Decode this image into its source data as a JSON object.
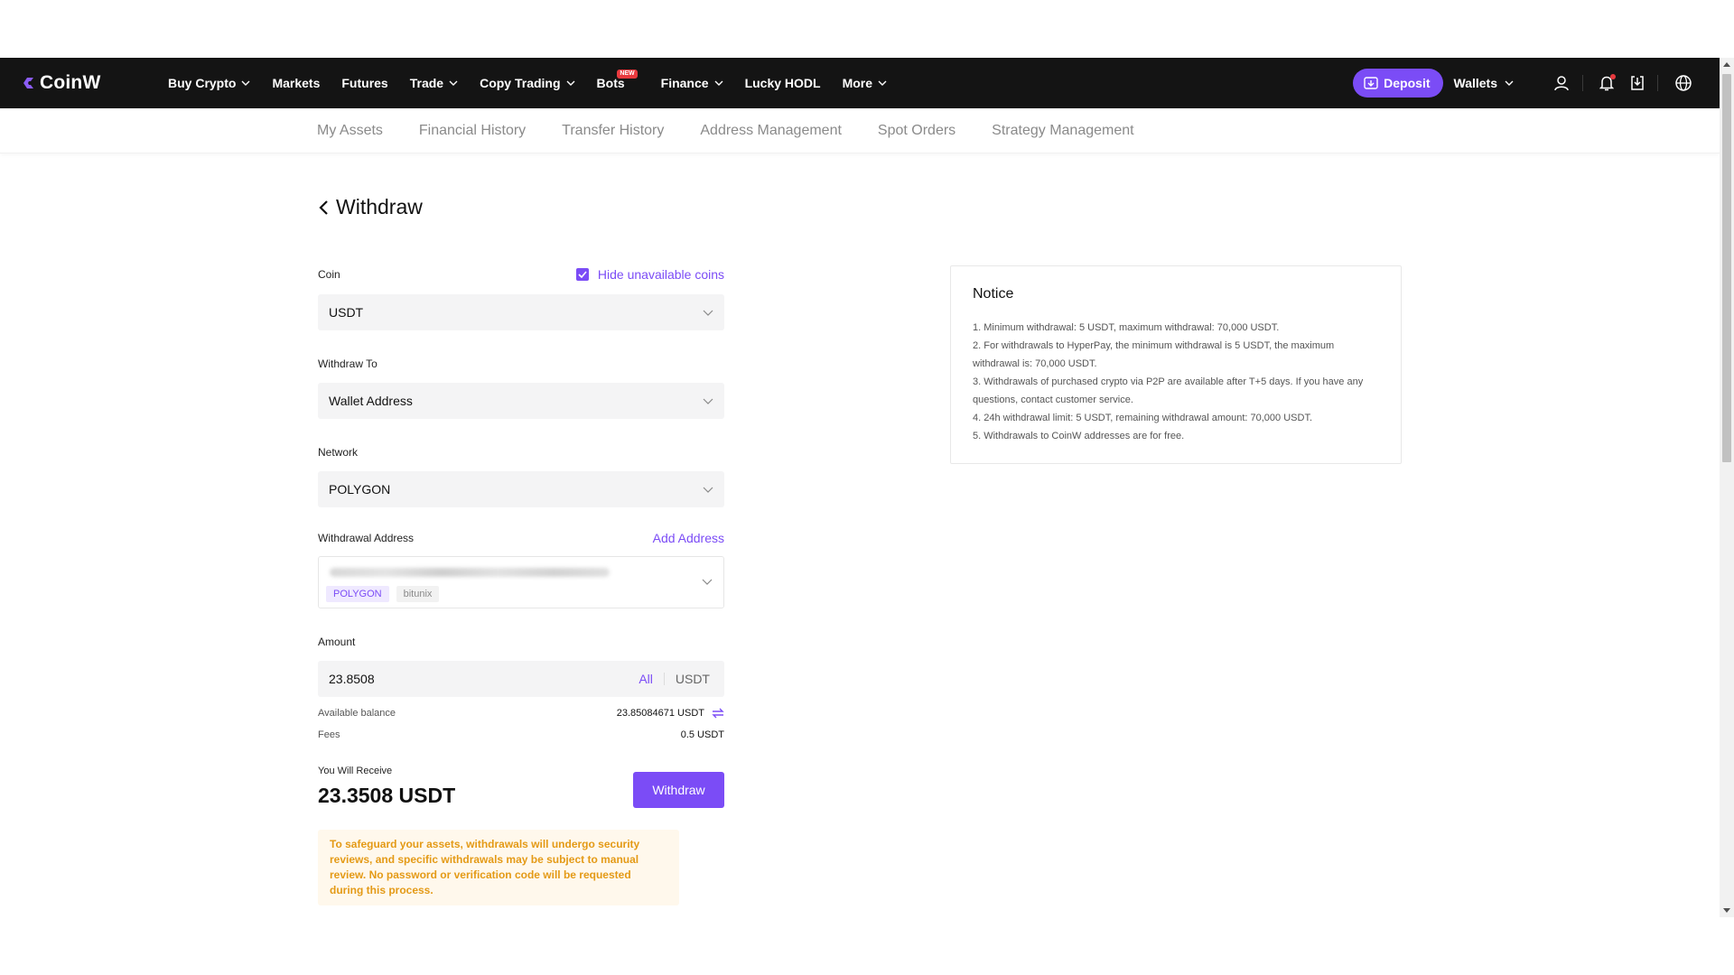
{
  "brand": {
    "name": "CoinW",
    "accent": "#7b4cf6",
    "navbar_bg": "#141414"
  },
  "nav": {
    "items": [
      {
        "label": "Buy Crypto",
        "dropdown": true
      },
      {
        "label": "Markets",
        "dropdown": false
      },
      {
        "label": "Futures",
        "dropdown": false
      },
      {
        "label": "Trade",
        "dropdown": true
      },
      {
        "label": "Copy Trading",
        "dropdown": true
      },
      {
        "label": "Bots",
        "dropdown": false,
        "badge": "NEW"
      },
      {
        "label": "Finance",
        "dropdown": true
      },
      {
        "label": "Lucky HODL",
        "dropdown": false
      },
      {
        "label": "More",
        "dropdown": true
      }
    ],
    "deposit_label": "Deposit",
    "wallets_label": "Wallets",
    "icons": [
      "user-icon",
      "bell-icon",
      "download-icon",
      "globe-icon"
    ]
  },
  "subnav": {
    "items": [
      "My Assets",
      "Financial History",
      "Transfer History",
      "Address Management",
      "Spot Orders",
      "Strategy Management"
    ]
  },
  "page": {
    "title": "Withdraw"
  },
  "form": {
    "coin": {
      "label": "Coin",
      "value": "USDT",
      "hide_unavailable_label": "Hide unavailable coins",
      "hide_unavailable_checked": true
    },
    "withdraw_to": {
      "label": "Withdraw To",
      "value": "Wallet Address"
    },
    "network": {
      "label": "Network",
      "value": "POLYGON"
    },
    "address": {
      "label": "Withdrawal Address",
      "add_label": "Add Address",
      "tags": [
        "POLYGON",
        "bitunix"
      ]
    },
    "amount": {
      "label": "Amount",
      "value": "23.8508",
      "all_label": "All",
      "unit": "USDT"
    },
    "available": {
      "label": "Available balance",
      "value": "23.85084671 USDT"
    },
    "fees": {
      "label": "Fees",
      "value": "0.5 USDT"
    },
    "receive": {
      "label": "You Will Receive",
      "value": "23.3508 USDT"
    },
    "withdraw_button": "Withdraw",
    "warning": "To safeguard your assets, withdrawals will undergo security reviews, and specific withdrawals may be subject to manual review. No password or verification code will be requested during this process."
  },
  "notice": {
    "title": "Notice",
    "items": [
      "1. Minimum withdrawal: 5 USDT, maximum withdrawal: 70,000 USDT.",
      "2. For withdrawals to HyperPay, the minimum withdrawal is 5 USDT, the maximum withdrawal is: 70,000 USDT.",
      "3. Withdrawals of purchased crypto via P2P are available after T+5 days. If you have any questions, contact customer service.",
      "4. 24h withdrawal limit: 5 USDT, remaining withdrawal amount: 70,000 USDT.",
      "5. Withdrawals to CoinW addresses are for free."
    ]
  }
}
